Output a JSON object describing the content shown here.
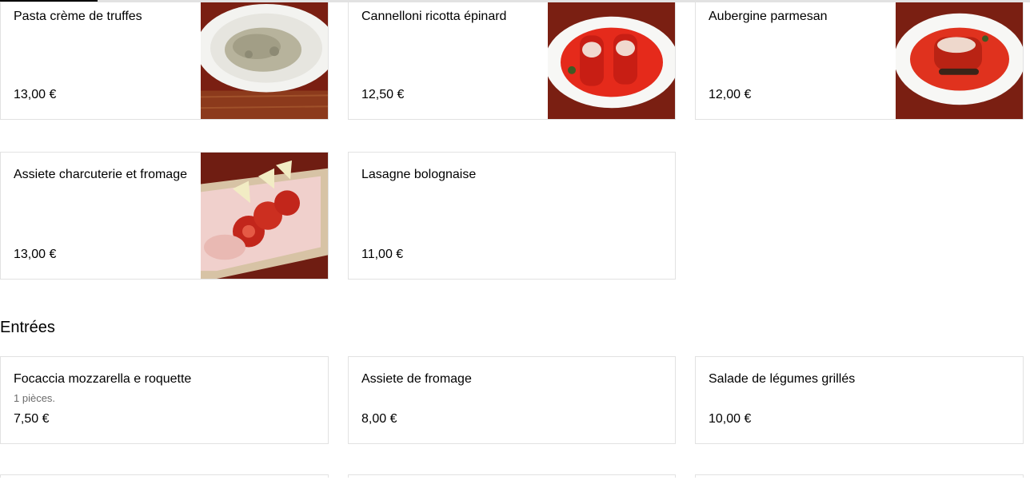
{
  "sections": [
    {
      "items": [
        {
          "name": "Pasta crème de truffes",
          "price": "13,00 €",
          "image": "truffle-pasta-photo"
        },
        {
          "name": "Cannelloni ricotta épinard",
          "price": "12,50 €",
          "image": "cannelloni-photo"
        },
        {
          "name": "Aubergine parmesan",
          "price": "12,00 €",
          "image": "aubergine-parmesan-photo"
        },
        {
          "name": "Assiete charcuterie et fromage",
          "price": "13,00 €",
          "image": "charcuterie-board-photo"
        },
        {
          "name": "Lasagne bolognaise",
          "price": "11,00 €"
        }
      ]
    },
    {
      "title": "Entrées",
      "items": [
        {
          "name": "Focaccia mozzarella e roquette",
          "description": "1 pièces.",
          "price": "7,50 €"
        },
        {
          "name": "Assiete de fromage",
          "price": "8,00 €"
        },
        {
          "name": "Salade de légumes grillés",
          "price": "10,00 €"
        }
      ]
    }
  ],
  "colors": {
    "border": "#e2e2e2",
    "text": "#000000",
    "muted_text": "#6b6b6b",
    "photo_background": "#7a1f12"
  }
}
